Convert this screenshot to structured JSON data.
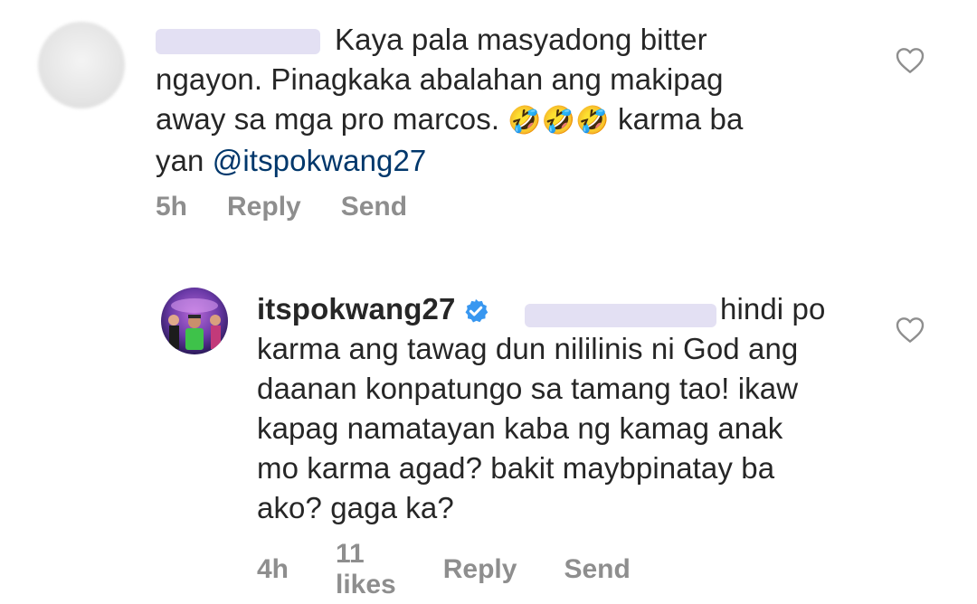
{
  "comments": [
    {
      "text_line1": "Kaya pala masyadong bitter",
      "text_line2": "ngayon. Pinagkaka abalahan ang makipag",
      "text_line3_before": "away sa mga pro marcos. ",
      "text_line3_emoji": "🤣🤣🤣",
      "text_line3_after": " karma ba",
      "text_line4_before": "yan ",
      "mention": "@itspokwang27",
      "meta": {
        "time": "5h",
        "reply": "Reply",
        "send": "Send"
      },
      "heart_icon": "heart-outline-icon"
    },
    {
      "username": "itspokwang27",
      "verified_icon": "verified-badge-icon",
      "text_line1_after": "hindi po",
      "text_lines": [
        "karma ang tawag dun nililinis ni God ang",
        "daanan konpatungo sa tamang tao! ikaw",
        "kapag namatayan kaba ng kamag anak",
        "mo karma agad? bakit maybpinatay ba",
        "ako? gaga ka?"
      ],
      "meta": {
        "time": "4h",
        "likes": "11 likes",
        "reply": "Reply",
        "send": "Send"
      },
      "heart_icon": "heart-outline-icon"
    }
  ],
  "colors": {
    "text": "#262626",
    "meta": "#8e8e8e",
    "mention": "#00376b",
    "verified": "#3897f0",
    "redaction": "#e3e0f3"
  }
}
